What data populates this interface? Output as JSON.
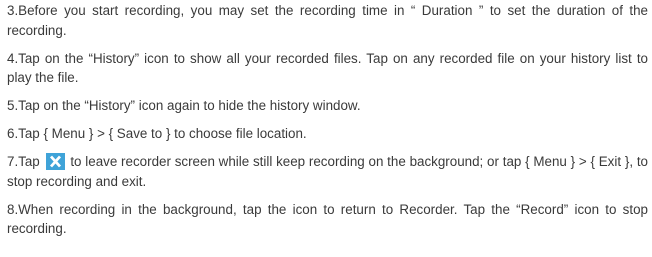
{
  "paragraphs": {
    "p3": "3.Before you start recording, you may set the recording time in “ Duration ” to set the duration of the recording.",
    "p4": "4.Tap on the “History” icon to show all your recorded files. Tap on any recorded file on your history list to play the file.",
    "p5": "5.Tap on the “History” icon again to hide the history window.",
    "p6": "6.Tap { Menu } > { Save to } to choose file location.",
    "p7_before": "7.Tap ",
    "p7_after": " to leave recorder screen while still keep recording on the background; or tap { Menu } > { Exit }, to stop recording and exit.",
    "p8": "8.When recording in the background, tap the icon to return to Recorder. Tap the “Record” icon to stop recording."
  },
  "icons": {
    "close_icon": "close-icon",
    "close_icon_bg": "#3fa3d8",
    "close_icon_fg": "#ffffff"
  }
}
